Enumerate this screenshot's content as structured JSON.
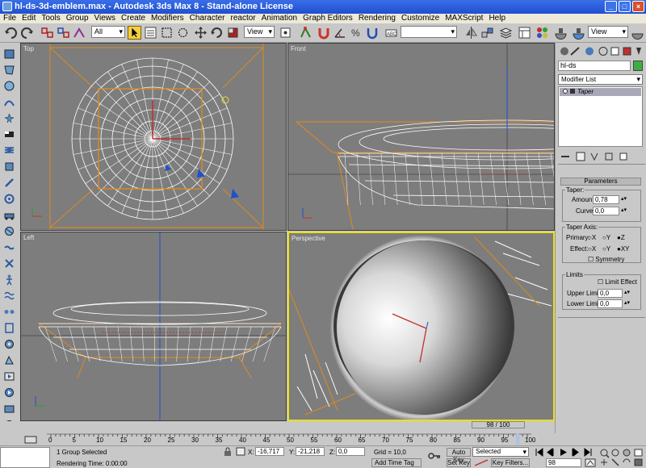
{
  "window": {
    "title": "hl-ds-3d-emblem.max - Autodesk 3ds Max 8 - Stand-alone License",
    "buttons": [
      "_",
      "□",
      "×"
    ]
  },
  "menu": [
    "File",
    "Edit",
    "Tools",
    "Group",
    "Views",
    "Create",
    "Modifiers",
    "Character",
    "reactor",
    "Animation",
    "Graph Editors",
    "Rendering",
    "Customize",
    "MAXScript",
    "Help"
  ],
  "toolbar": {
    "selection_filter": "All",
    "ref_coord": "View",
    "named_sel": "",
    "view2": "View"
  },
  "viewports": {
    "top": "Top",
    "front": "Front",
    "left": "Left",
    "perspective": "Perspective"
  },
  "panel": {
    "object_name": "hl-ds",
    "object_color": "#3fae3f",
    "modifier_list": "Modifier List",
    "stack_item": "Taper",
    "rollout": "Parameters",
    "taper_group": "Taper:",
    "amount_label": "Amount:",
    "amount": "0,78",
    "curve_label": "Curve:",
    "curve": "0,0",
    "axis_group": "Taper Axis:",
    "primary_label": "Primary:",
    "effect_label": "Effect:",
    "primary_opts": [
      "X",
      "Y",
      "Z"
    ],
    "effect_opts": [
      "X",
      "Y",
      "XY"
    ],
    "symmetry": "Symmetry",
    "limits_group": "Limits",
    "limit_effect": "Limit Effect",
    "upper_label": "Upper Limit:",
    "upper": "0,0",
    "lower_label": "Lower Limit:",
    "lower": "0,0"
  },
  "timeline": {
    "slider": "98 / 100",
    "ticks": [
      "0",
      "5",
      "10",
      "15",
      "20",
      "25",
      "30",
      "35",
      "40",
      "45",
      "50",
      "55",
      "60",
      "65",
      "70",
      "75",
      "80",
      "85",
      "90",
      "95",
      "100"
    ],
    "current_fraction": 0.98
  },
  "status": {
    "selection": "1 Group Selected",
    "prompt": "Rendering Time: 0:00:00",
    "x_label": "X:",
    "x": "-16,717",
    "y_label": "Y:",
    "y": "-21,218",
    "z_label": "Z:",
    "z": "0,0",
    "grid": "Grid = 10,0",
    "add_time_tag": "Add Time Tag",
    "auto_key": "Auto Key",
    "set_key": "Set Key",
    "key_mode": "Selected",
    "key_filters": "Key Filters...",
    "frame": "98"
  },
  "colors": {
    "viewport_bg": "#7d7d7d",
    "wire": "#ffffff",
    "orange": "#e08a1c",
    "active": "#e8e020",
    "accent": "#1f4fd0"
  }
}
